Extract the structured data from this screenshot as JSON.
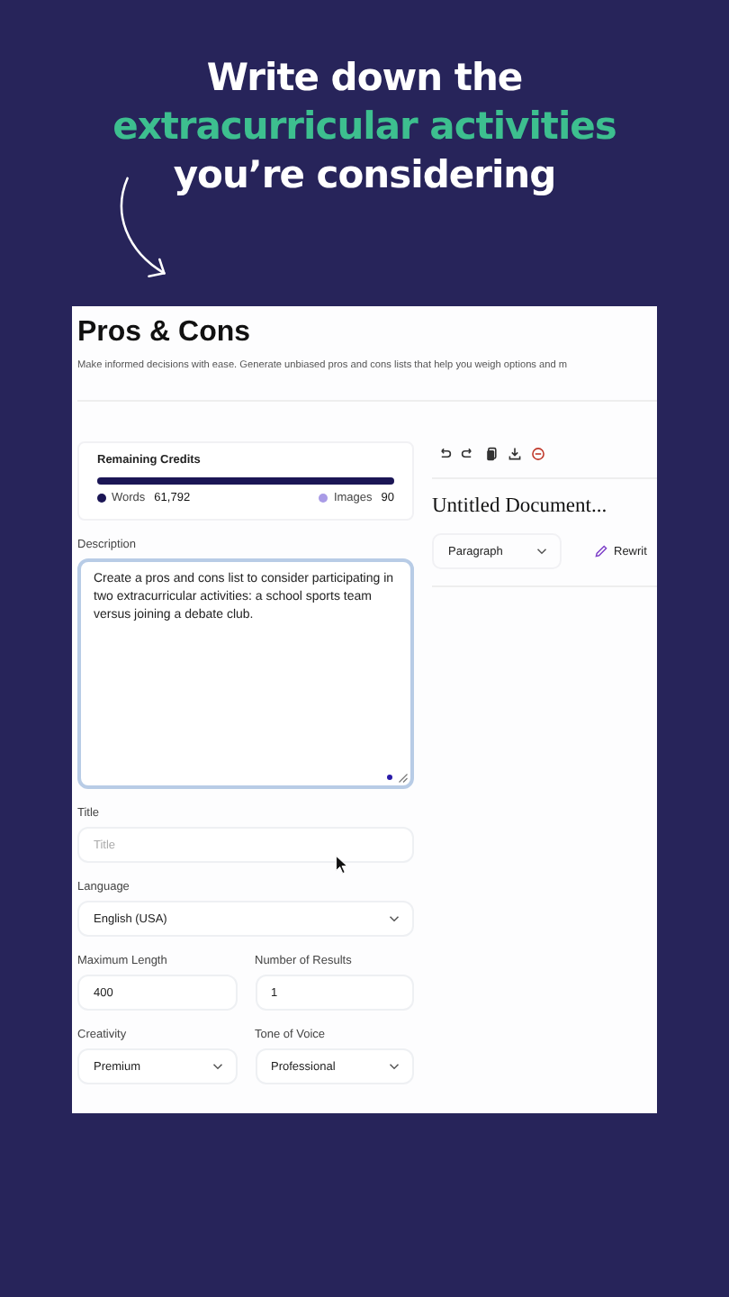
{
  "headline": [
    {
      "text": "Write down the",
      "highlight": false
    },
    {
      "text": "extracurricular activities",
      "highlight": true
    },
    {
      "text": "you’re considering",
      "highlight": false
    }
  ],
  "app": {
    "title": "Pros & Cons",
    "subtitle": "Make informed decisions with ease. Generate unbiased pros and cons lists that help you weigh options and m",
    "credits": {
      "label": "Remaining Credits",
      "level": 1,
      "items": [
        {
          "name": "Words",
          "value": "61,792",
          "color": "#1b1655"
        },
        {
          "name": "Images",
          "value": "90",
          "color": "#a99be6"
        }
      ]
    },
    "description": {
      "label": "Description",
      "value": "Create a pros and cons list to consider participating in two extracurricular activities: a school sports team versus joining a debate club."
    },
    "field_rows": [
      [
        {
          "label": "Title",
          "kind": "input",
          "placeholder": "Title"
        }
      ],
      [
        {
          "label": "Language",
          "kind": "select",
          "value": "English (USA)"
        }
      ],
      [
        {
          "label": "Maximum Length",
          "kind": "input",
          "value": "400"
        },
        {
          "label": "Number of Results",
          "kind": "input",
          "value": "1"
        }
      ],
      [
        {
          "label": "Creativity",
          "kind": "select",
          "value": "Premium"
        },
        {
          "label": "Tone of Voice",
          "kind": "select",
          "value": "Professional"
        }
      ]
    ],
    "document": {
      "title": "Untitled Document...",
      "format": "Paragraph",
      "rewrite": "Rewrit"
    }
  }
}
